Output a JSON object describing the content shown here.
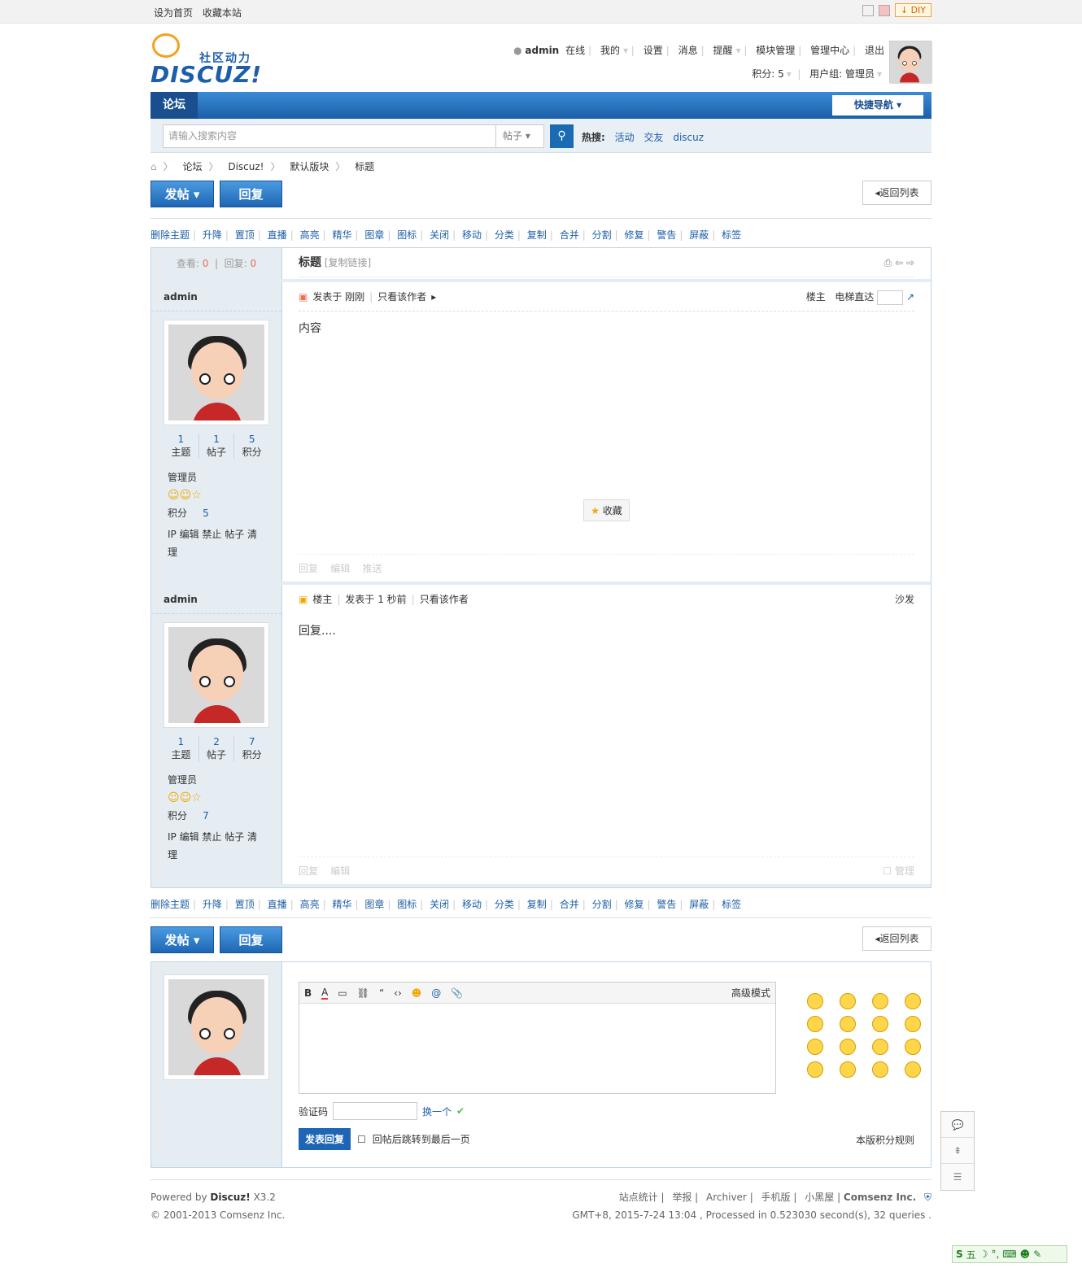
{
  "topbar": {
    "set_home": "设为首页",
    "bookmark": "收藏本站",
    "diy": "DIY"
  },
  "logo": {
    "sub": "社区动力",
    "main": "DISCUZ!"
  },
  "user": {
    "name": "admin",
    "status": "在线",
    "mine": "我的",
    "settings": "设置",
    "messages": "消息",
    "notice": "提醒",
    "modules": "模块管理",
    "admin": "管理中心",
    "logout": "退出",
    "points": "积分: 5",
    "group": "用户组: 管理员"
  },
  "nav": {
    "forum": "论坛",
    "quick": "快捷导航"
  },
  "search": {
    "placeholder": "请输入搜索内容",
    "type": "帖子",
    "hot_label": "热搜:",
    "hot": [
      "活动",
      "交友",
      "discuz"
    ]
  },
  "breadcrumb": [
    "论坛",
    "Discuz!",
    "默认版块",
    "标题"
  ],
  "buttons": {
    "post": "发帖",
    "reply": "回复",
    "back": "返回列表"
  },
  "modactions": [
    "删除主题",
    "升降",
    "置顶",
    "直播",
    "高亮",
    "精华",
    "图章",
    "图标",
    "关闭",
    "移动",
    "分类",
    "复制",
    "合并",
    "分割",
    "修复",
    "警告",
    "屏蔽",
    "标签"
  ],
  "thread": {
    "views_label": "查看:",
    "views": "0",
    "replies_label": "回复:",
    "replies": "0",
    "title": "标题",
    "copy": "[复制链接]"
  },
  "posts": [
    {
      "author": "admin",
      "threads": "1",
      "posts": "1",
      "credits": "5",
      "group": "管理员",
      "credit_label": "积分",
      "credit_value": "5",
      "actions": "IP 编辑 禁止 帖子 清理",
      "meta": "发表于 刚刚",
      "only_author": "只看该作者",
      "floor": "楼主",
      "jump": "电梯直达",
      "content": "内容",
      "fav": "收藏",
      "reply": "回复",
      "edit": "编辑",
      "push": "推送"
    },
    {
      "author": "admin",
      "threads": "1",
      "posts": "2",
      "credits": "7",
      "group": "管理员",
      "credit_label": "积分",
      "credit_value": "7",
      "actions": "IP 编辑 禁止 帖子 清理",
      "role": "楼主",
      "meta": "发表于 1 秒前",
      "only_author": "只看该作者",
      "floor": "沙发",
      "content": "回复....",
      "reply": "回复",
      "edit": "编辑",
      "manage": "管理"
    }
  ],
  "stat_labels": {
    "threads": "主题",
    "posts": "帖子",
    "credits": "积分"
  },
  "editor": {
    "advanced": "高级模式",
    "captcha": "验证码",
    "change": "换一个",
    "submit": "发表回复",
    "jump_last": "回帖后跳转到最后一页",
    "rules": "本版积分规则"
  },
  "footer": {
    "powered": "Powered by",
    "brand": "Discuz!",
    "version": "X3.2",
    "copy": "© 2001-2013 Comsenz Inc.",
    "links": [
      "站点统计",
      "举报",
      "Archiver",
      "手机版",
      "小黑屋",
      "Comsenz Inc."
    ],
    "info": "GMT+8, 2015-7-24 13:04 , Processed in 0.523030 second(s), 32 queries ."
  },
  "ime": {
    "label": "五"
  }
}
